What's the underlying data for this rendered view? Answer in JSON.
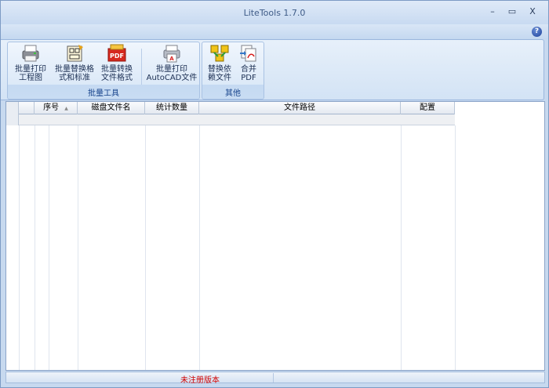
{
  "window": {
    "title": "LiteTools 1.7.0",
    "min_glyph": "–",
    "max_glyph": "▭",
    "close_glyph": "X"
  },
  "ribbon": {
    "help_glyph": "?",
    "groups": [
      {
        "label": "批量工具",
        "buttons": [
          {
            "line1": "批量打印",
            "line2": "工程图",
            "icon": "printer-drawing-icon"
          },
          {
            "line1": "批量替换格",
            "line2": "式和标准",
            "icon": "drawing-replace-icon"
          },
          {
            "line1": "批量转换",
            "line2": "文件格式",
            "icon": "pdf-convert-icon"
          },
          {
            "line1": "批量打印",
            "line2": "AutoCAD文件",
            "icon": "autocad-print-icon"
          }
        ]
      },
      {
        "label": "其他",
        "buttons": [
          {
            "line1": "替换依",
            "line2": "赖文件",
            "icon": "replace-dependency-icon"
          },
          {
            "line1": "合并",
            "line2": "PDF",
            "icon": "merge-pdf-icon"
          }
        ]
      }
    ]
  },
  "grid": {
    "columns": [
      {
        "label": ""
      },
      {
        "label": ""
      },
      {
        "label": "序号"
      },
      {
        "label": "磁盘文件名"
      },
      {
        "label": "统计数量"
      },
      {
        "label": "文件路径"
      },
      {
        "label": "配置"
      }
    ],
    "sort_glyph": "▲"
  },
  "status": {
    "text": "未注册版本"
  }
}
